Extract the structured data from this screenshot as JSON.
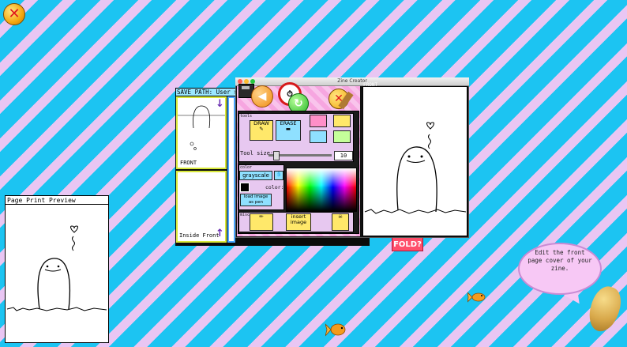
{
  "app_close_icon": "close-icon",
  "print_preview": {
    "label": "Page Print Preview"
  },
  "editor": {
    "save_path": "SAVE PATH: User > De",
    "window_title": "Zine Creator",
    "pages": [
      {
        "label": "FRONT"
      },
      {
        "label": "Inside Front"
      }
    ],
    "canvas_label": "FRONT",
    "fold_button": "FOLD?",
    "top_toolbar": [
      {
        "icon": "save-disk-icon"
      },
      {
        "icon": "back-arrow-icon"
      },
      {
        "icon": "alarm-clock-icon"
      },
      {
        "icon": "redo-arrow-icon"
      },
      {
        "icon": "close-icon"
      },
      {
        "icon": "broom-icon"
      }
    ],
    "tools": {
      "draw": "DRAW",
      "erase": "ERASE",
      "tool_size_label": "Tool size:",
      "tool_size_value": "10",
      "grayscale": "grayscale",
      "color_label": "color:",
      "texture_label": "load image as pen texture",
      "insert_image": "insert image",
      "section_tools": "tools",
      "section_color": "color",
      "section_misc": "misc"
    }
  },
  "tooltip": {
    "text": "Edit the front page cover of your zine."
  },
  "colors": {
    "accent_blue": "#1cc4f2",
    "accent_pink": "#e9c6f3",
    "fold": "#ff4f6a"
  }
}
